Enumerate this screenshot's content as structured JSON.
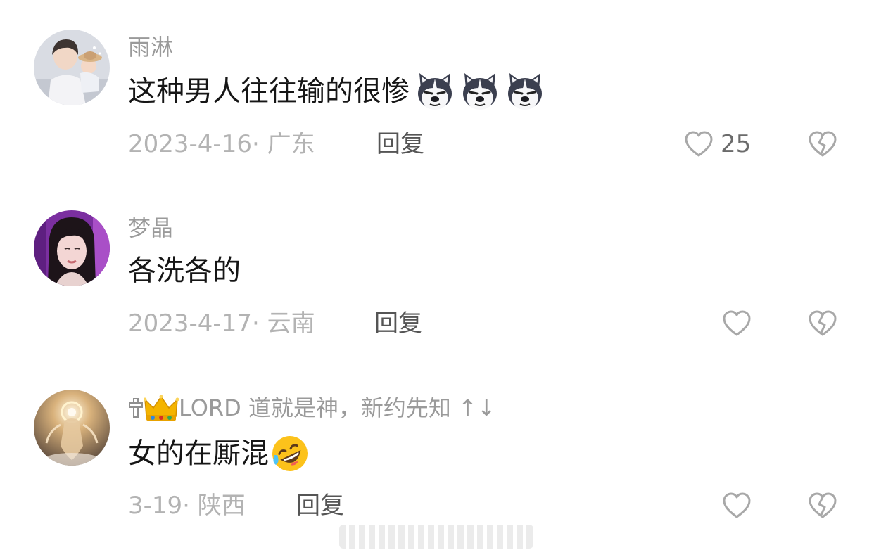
{
  "comments": [
    {
      "username": "雨淋",
      "text": "这种男人往往输的很惨",
      "emojis": [
        "husky-emoji",
        "husky-emoji",
        "husky-emoji"
      ],
      "date_location": "2023-4-16· 广东",
      "reply_label": "回复",
      "like_count": "25"
    },
    {
      "username": "梦晶",
      "text": "各洗各的",
      "date_location": "2023-4-17· 云南",
      "reply_label": "回复",
      "like_count": ""
    },
    {
      "username_prefix_icons": [
        "cross-icon",
        "crown-emoji"
      ],
      "username": "LORD 道就是神，新约先知 ↑↓",
      "text": "女的在厮混",
      "emojis": [
        "rofl-emoji"
      ],
      "date_location": "3-19· 陕西",
      "reply_label": "回复",
      "like_count": ""
    }
  ],
  "colors": {
    "username": "#9a9a9a",
    "text": "#161616",
    "meta": "#b3b3b3",
    "reply": "#555555",
    "icon_stroke": "#a8a8a8"
  }
}
